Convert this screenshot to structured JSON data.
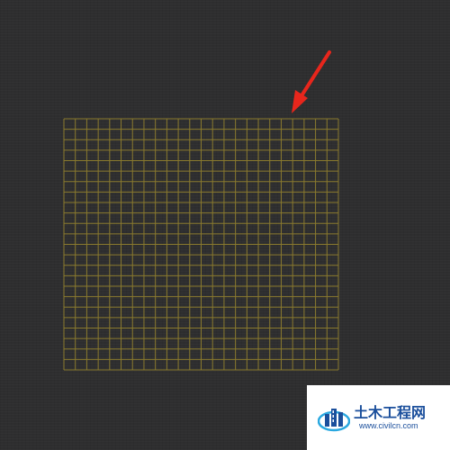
{
  "canvas": {
    "background_color": "#2e2e2f"
  },
  "grid": {
    "rows": 24,
    "cols": 24,
    "line_color": "#8a7a2e"
  },
  "arrow": {
    "color": "#e8261c",
    "icon": "red-pointer-arrow-icon"
  },
  "watermark": {
    "title": "土木工程网",
    "url": "www.civilcn.com",
    "brand_color": "#1b4f9c",
    "accent_color": "#2aa8e0",
    "icon": "civilcn-logo-icon"
  }
}
